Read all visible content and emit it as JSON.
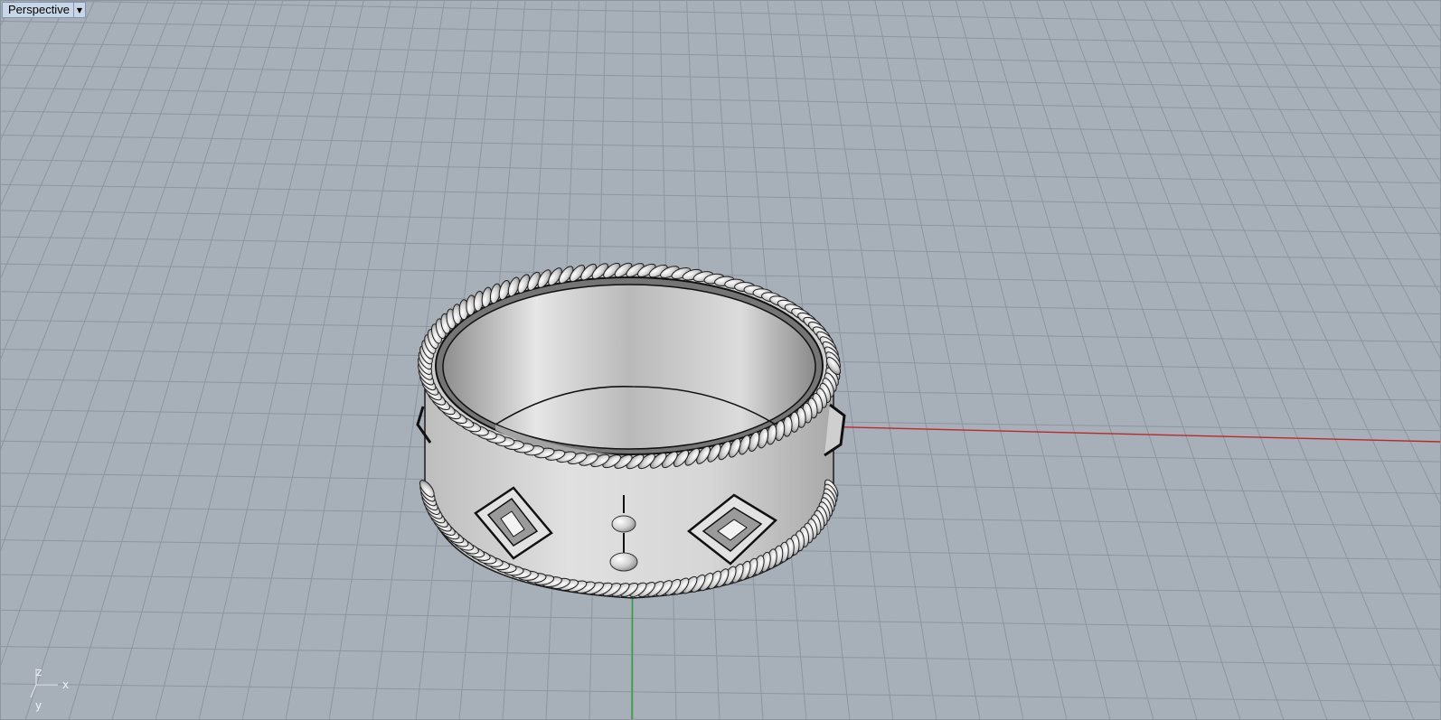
{
  "viewport": {
    "title": "Perspective",
    "menu_icon": "triangle-down-icon"
  },
  "axis_widget": {
    "z_label": "z",
    "x_label": "x",
    "y_label": "y"
  },
  "colors": {
    "background": "#a7afb8",
    "grid_line": "#8d96a0",
    "x_axis": "#b8292c",
    "y_axis": "#2e9e3a",
    "model": "#d2d2d2"
  }
}
